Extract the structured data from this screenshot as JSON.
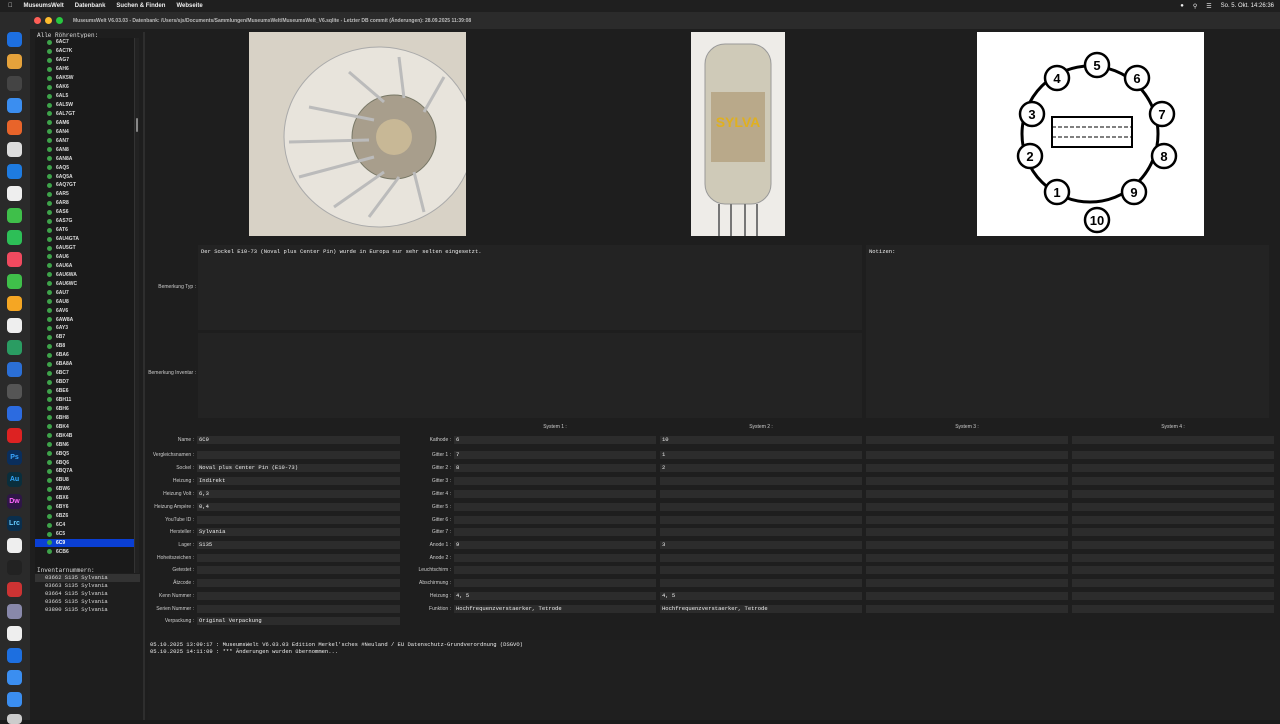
{
  "menubar": {
    "app_name": "MuseumsWelt",
    "items": [
      "Datenbank",
      "Suchen & Finden",
      "Webseite"
    ],
    "clock": "So. 5. Okt.  14:26:36"
  },
  "window": {
    "title": "MuseumsWelt V6.03.03 - Datenbank: /Users/sjs/Documents/Sammlungen/MuseumsWelt/MuseumsWelt_V6.sqlite - Letzter DB commit (Änderungen): 28.09.2025 11:39:08"
  },
  "tree": {
    "label": "Alle Röhrentypen:",
    "items": [
      "6AC7",
      "6AC7K",
      "6AG7",
      "6AH6",
      "6AK5W",
      "6AK6",
      "6AL5",
      "6AL5W",
      "6AL7GT",
      "6AM6",
      "6AN4",
      "6AN7",
      "6AN8",
      "6AN8A",
      "6AQ5",
      "6AQ5A",
      "6AQ7GT",
      "6AR5",
      "6AR8",
      "6AS6",
      "6AS7G",
      "6AT6",
      "6AU4GTA",
      "6AU5GT",
      "6AU6",
      "6AU6A",
      "6AU6WA",
      "6AU6WC",
      "6AU7",
      "6AU8",
      "6AV6",
      "6AW8A",
      "6AY3",
      "6B7",
      "6B8",
      "6BA6",
      "6BA8A",
      "6BC7",
      "6BD7",
      "6BE6",
      "6BH11",
      "6BH6",
      "6BH8",
      "6BK4",
      "6BK4B",
      "6BN6",
      "6BQ5",
      "6BQ6",
      "6BQ7A",
      "6BU8",
      "6BW6",
      "6BX6",
      "6BY6",
      "6BZ6",
      "6C4",
      "6C5",
      "6C9",
      "6CB6"
    ],
    "selected": "6C9"
  },
  "inventory": {
    "label": "Inventarnummern:",
    "items": [
      "03662 S135 Sylvania",
      "03663 S135 Sylvania",
      "03664 S135 Sylvania",
      "03665 S135 Sylvania",
      "03800 S135 Sylvania"
    ]
  },
  "images": {
    "photo1": "tube-socket-pins-photo",
    "photo2": "sylvania-tube-photo",
    "diagram": "pinout-diagram"
  },
  "remarks": {
    "type_label": "Bemerkung Typ :",
    "type_text": "Der Sockel E10-73 (Noval plus Center Pin) wurde in Europa nur sehr selten eingesetzt.",
    "inventar_label": "Bemerkung Inventar :",
    "inventar_text": "",
    "notes_label": "Notizen:",
    "notes_text": ""
  },
  "fields": [
    {
      "label": "Name :",
      "value": "6C9"
    },
    {
      "label": "Vergleichsnamen :",
      "value": ""
    },
    {
      "label": "Sockel :",
      "value": "Noval plus Center Pin (E10-73)"
    },
    {
      "label": "Heizung :",
      "value": "Indirekt"
    },
    {
      "label": "Heizung Volt :",
      "value": "6,3"
    },
    {
      "label": "Heizung Ampère :",
      "value": "0,4"
    },
    {
      "label": "YouTube ID :",
      "value": ""
    },
    {
      "label": "Hersteller :",
      "value": "Sylvania"
    },
    {
      "label": "Lager :",
      "value": "S135"
    },
    {
      "label": "Hoheitszeichen :",
      "value": ""
    },
    {
      "label": "Getestet :",
      "value": ""
    },
    {
      "label": "Ätzcode :",
      "value": ""
    },
    {
      "label": "Kenn Nummer :",
      "value": ""
    },
    {
      "label": "Serien Nummer :",
      "value": ""
    },
    {
      "label": "Verpackung :",
      "value": "Original Verpackung"
    }
  ],
  "systems": {
    "headers": [
      "System 1 :",
      "System 2 :",
      "System 3 :",
      "System 4 :"
    ],
    "rows": [
      {
        "label": "Kathode :",
        "values": [
          "6",
          "10",
          "",
          ""
        ]
      },
      {
        "label": "Gitter 1 :",
        "values": [
          "7",
          "1",
          "",
          ""
        ]
      },
      {
        "label": "Gitter 2 :",
        "values": [
          "8",
          "2",
          "",
          ""
        ]
      },
      {
        "label": "Gitter 3 :",
        "values": [
          "",
          "",
          "",
          ""
        ]
      },
      {
        "label": "Gitter 4 :",
        "values": [
          "",
          "",
          "",
          ""
        ]
      },
      {
        "label": "Gitter 5 :",
        "values": [
          "",
          "",
          "",
          ""
        ]
      },
      {
        "label": "Gitter 6 :",
        "values": [
          "",
          "",
          "",
          ""
        ]
      },
      {
        "label": "Gitter 7 :",
        "values": [
          "",
          "",
          "",
          ""
        ]
      },
      {
        "label": "Anode 1 :",
        "values": [
          "9",
          "3",
          "",
          ""
        ]
      },
      {
        "label": "Anode 2 :",
        "values": [
          "",
          "",
          "",
          ""
        ]
      },
      {
        "label": "Leuchtschirm :",
        "values": [
          "",
          "",
          "",
          ""
        ]
      },
      {
        "label": "Abschirmung :",
        "values": [
          "",
          "",
          "",
          ""
        ]
      },
      {
        "label": "Heizung :",
        "values": [
          "4, 5",
          "4, 5",
          "",
          ""
        ]
      },
      {
        "label": "Funktion :",
        "values": [
          "Hochfrequenzverstaerker, Tetrode",
          "Hochfrequenzverstaerker, Tetrode",
          "",
          ""
        ]
      }
    ]
  },
  "log": [
    "05.10.2025 13:09:17 : MuseumsWelt V6.03.03 Edition Merkel'sches #Neuland / EU Datenschutz-Grundverordnung (DSGVO)",
    "05.10.2025 14:11:09 : *** Änderungen wurden übernommen..."
  ]
}
